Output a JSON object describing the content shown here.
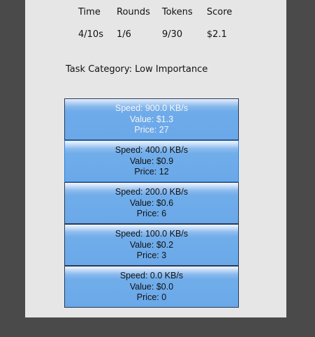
{
  "stats": {
    "headers": [
      "Time",
      "Rounds",
      "Tokens",
      "Score"
    ],
    "values": [
      "4/10s",
      "1/6",
      "9/30",
      "$2.1"
    ]
  },
  "task": {
    "label": "Task Category: Low Importance"
  },
  "options": [
    {
      "speed": "Speed: 900.0 KB/s",
      "value": "Value: $1.3",
      "price": "Price: 27"
    },
    {
      "speed": "Speed: 400.0 KB/s",
      "value": "Value: $0.9",
      "price": "Price: 12"
    },
    {
      "speed": "Speed: 200.0 KB/s",
      "value": "Value: $0.6",
      "price": "Price: 6"
    },
    {
      "speed": "Speed: 100.0 KB/s",
      "value": "Value: $0.2",
      "price": "Price: 3"
    },
    {
      "speed": "Speed: 0.0 KB/s",
      "value": "Value: $0.0",
      "price": "Price: 0"
    }
  ],
  "colors": {
    "background": "#4a4a4a",
    "panel": "#e6e6e6",
    "button": "#6aa8e9",
    "button_border": "#2a3a55"
  }
}
